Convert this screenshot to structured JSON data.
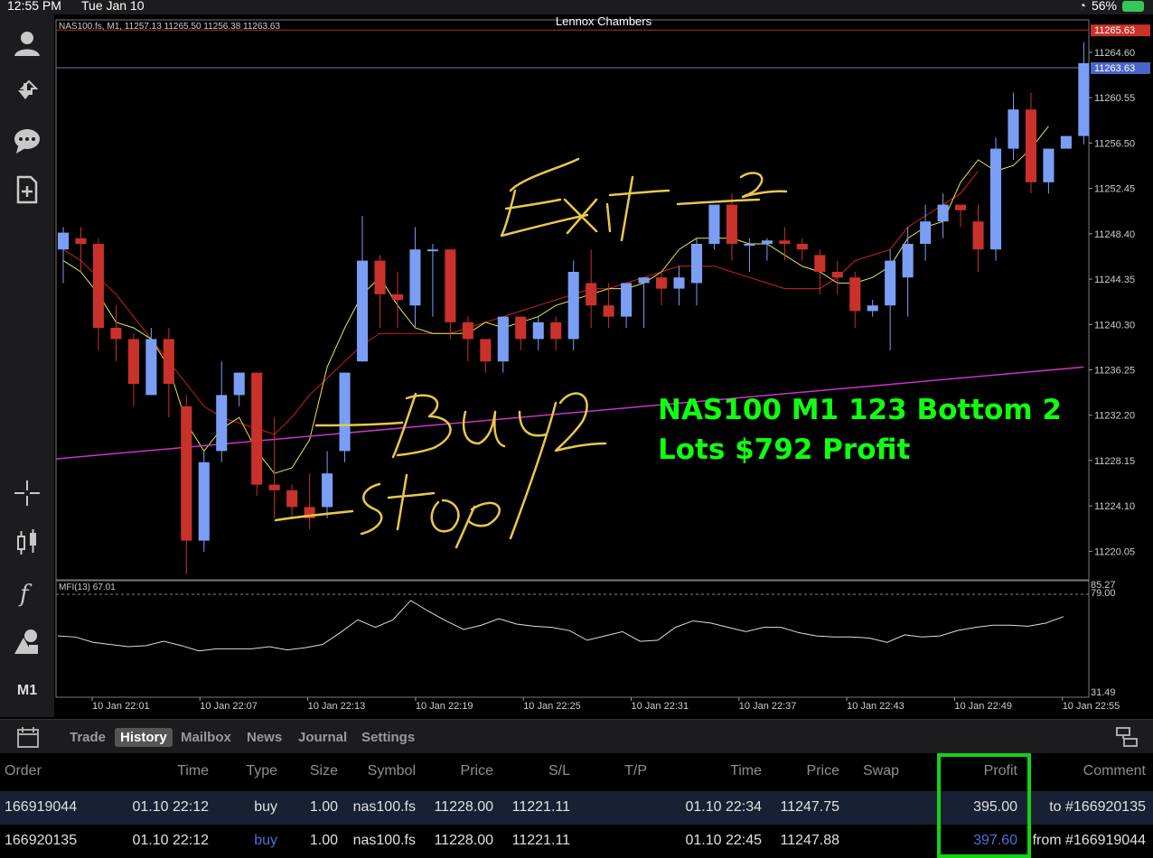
{
  "status_bar": {
    "time": "12:55 PM",
    "date": "Tue Jan 10",
    "battery": "56%"
  },
  "chart": {
    "account_title": "Lennox Chambers",
    "symbol_info": "NAS100.fs, M1, 11257.13 11265.50 11256.38 11263.63",
    "mfi_info": "MFI(13) 67.01",
    "overlay_text_line1": "NAS100 M1 123 Bottom 2",
    "overlay_text_line2": "Lots $792 Profit",
    "annotations": [
      "Exit 2",
      "Buy2",
      "Stop"
    ],
    "timeframe": "M1",
    "current_price_bid": "11263.63",
    "high_price": "11265.63",
    "mfi_levels": [
      "85.27",
      "79.00",
      "31.49"
    ],
    "colors": {
      "bull": "#7b9ef5",
      "bear": "#c8322a",
      "ma_fast": "#e8e84a",
      "ma_slow": "#cc2222",
      "ma_long": "#cc33cc",
      "mfi": "#dddddd",
      "ink": "#e8c84a",
      "overlay": "#11ff11",
      "highlight": "#13d313"
    }
  },
  "chart_data": {
    "type": "candlestick",
    "ylim": [
      11217.5,
      11267.5
    ],
    "y_ticks": [
      "11264.60",
      "11260.55",
      "11256.50",
      "11252.45",
      "11248.40",
      "11244.35",
      "11240.30",
      "11236.25",
      "11232.20",
      "11228.15",
      "11224.10",
      "11220.05"
    ],
    "x_ticks": [
      "10 Jan 22:01",
      "10 Jan 22:07",
      "10 Jan 22:13",
      "10 Jan 22:19",
      "10 Jan 22:25",
      "10 Jan 22:31",
      "10 Jan 22:37",
      "10 Jan 22:43",
      "10 Jan 22:49",
      "10 Jan 22:55"
    ],
    "candles": [
      {
        "o": 11247,
        "h": 11249,
        "c": 11248.5,
        "l": 11244
      },
      {
        "o": 11248,
        "h": 11249,
        "c": 11247.5,
        "l": 11245
      },
      {
        "o": 11247.5,
        "h": 11248,
        "c": 11240,
        "l": 11238
      },
      {
        "o": 11240,
        "h": 11242,
        "c": 11239,
        "l": 11237
      },
      {
        "o": 11239,
        "h": 11239.5,
        "c": 11235,
        "l": 11233
      },
      {
        "o": 11234,
        "h": 11240,
        "c": 11239,
        "l": 11234
      },
      {
        "o": 11239,
        "h": 11240,
        "c": 11235,
        "l": 11232
      },
      {
        "o": 11233,
        "h": 11234,
        "c": 11221,
        "l": 11218
      },
      {
        "o": 11221,
        "h": 11229,
        "c": 11228,
        "l": 11220
      },
      {
        "o": 11229,
        "h": 11237,
        "c": 11234,
        "l": 11228
      },
      {
        "o": 11234,
        "h": 11236,
        "c": 11236,
        "l": 11233
      },
      {
        "o": 11236,
        "h": 11236,
        "c": 11226,
        "l": 11225
      },
      {
        "o": 11226,
        "h": 11232,
        "c": 11225.5,
        "l": 11223
      },
      {
        "o": 11225.5,
        "h": 11226,
        "c": 11224,
        "l": 11223
      },
      {
        "o": 11224,
        "h": 11227,
        "c": 11223,
        "l": 11222
      },
      {
        "o": 11224,
        "h": 11229,
        "c": 11227,
        "l": 11223
      },
      {
        "o": 11229,
        "h": 11236,
        "c": 11236,
        "l": 11228
      },
      {
        "o": 11237,
        "h": 11250,
        "c": 11246,
        "l": 11237
      },
      {
        "o": 11246,
        "h": 11246.5,
        "c": 11243,
        "l": 11240
      },
      {
        "o": 11243,
        "h": 11245,
        "c": 11242.5,
        "l": 11240
      },
      {
        "o": 11242,
        "h": 11249,
        "c": 11247,
        "l": 11240
      },
      {
        "o": 11247,
        "h": 11247.5,
        "c": 11247,
        "l": 11241
      },
      {
        "o": 11247,
        "h": 11247,
        "c": 11240.5,
        "l": 11239
      },
      {
        "o": 11240.5,
        "h": 11241,
        "c": 11239,
        "l": 11237
      },
      {
        "o": 11239,
        "h": 11239,
        "c": 11237,
        "l": 11236
      },
      {
        "o": 11237,
        "h": 11241,
        "c": 11241,
        "l": 11236
      },
      {
        "o": 11241,
        "h": 11241,
        "c": 11239,
        "l": 11238
      },
      {
        "o": 11239,
        "h": 11241,
        "c": 11240.5,
        "l": 11238
      },
      {
        "o": 11240.5,
        "h": 11241,
        "c": 11239,
        "l": 11238
      },
      {
        "o": 11239,
        "h": 11246,
        "c": 11245,
        "l": 11238
      },
      {
        "o": 11244,
        "h": 11247,
        "c": 11242,
        "l": 11240
      },
      {
        "o": 11242,
        "h": 11244,
        "c": 11241,
        "l": 11240
      },
      {
        "o": 11241,
        "h": 11244,
        "c": 11244,
        "l": 11240
      },
      {
        "o": 11244,
        "h": 11244.5,
        "c": 11244.5,
        "l": 11240
      },
      {
        "o": 11244.5,
        "h": 11245,
        "c": 11243.5,
        "l": 11242
      },
      {
        "o": 11243.5,
        "h": 11245.5,
        "c": 11244.5,
        "l": 11242
      },
      {
        "o": 11244,
        "h": 11248,
        "c": 11247.5,
        "l": 11242
      },
      {
        "o": 11247.5,
        "h": 11250,
        "c": 11251,
        "l": 11247
      },
      {
        "o": 11251,
        "h": 11252,
        "c": 11247.5,
        "l": 11246
      },
      {
        "o": 11247.5,
        "h": 11248,
        "c": 11247.5,
        "l": 11245
      },
      {
        "o": 11247.5,
        "h": 11248,
        "c": 11247.8,
        "l": 11246
      },
      {
        "o": 11247.8,
        "h": 11249,
        "c": 11247.5,
        "l": 11246
      },
      {
        "o": 11247.5,
        "h": 11248,
        "c": 11247,
        "l": 11246
      },
      {
        "o": 11246.5,
        "h": 11247,
        "c": 11245,
        "l": 11243
      },
      {
        "o": 11245,
        "h": 11246,
        "c": 11244.5,
        "l": 11243
      },
      {
        "o": 11244.5,
        "h": 11245,
        "c": 11241.5,
        "l": 11240
      },
      {
        "o": 11241.5,
        "h": 11242.5,
        "c": 11242,
        "l": 11241
      },
      {
        "o": 11242,
        "h": 11247,
        "c": 11246,
        "l": 11238
      },
      {
        "o": 11244.5,
        "h": 11249,
        "c": 11247.5,
        "l": 11241
      },
      {
        "o": 11247.5,
        "h": 11251,
        "c": 11249.5,
        "l": 11246
      },
      {
        "o": 11249.5,
        "h": 11252,
        "c": 11251,
        "l": 11248
      },
      {
        "o": 11251,
        "h": 11251,
        "c": 11250.5,
        "l": 11249
      },
      {
        "o": 11249.5,
        "h": 11251,
        "c": 11247,
        "l": 11245
      },
      {
        "o": 11247,
        "h": 11257,
        "c": 11256,
        "l": 11246
      },
      {
        "o": 11256,
        "h": 11261,
        "c": 11259.5,
        "l": 11255
      },
      {
        "o": 11259.5,
        "h": 11261,
        "c": 11253,
        "l": 11252
      },
      {
        "o": 11253,
        "h": 11256,
        "c": 11256,
        "l": 11252
      },
      {
        "o": 11256,
        "h": 11256,
        "c": 11257.13,
        "l": 11256
      },
      {
        "o": 11257.13,
        "h": 11265.5,
        "c": 11263.63,
        "l": 11256.38
      }
    ],
    "ma_fast": [
      11246,
      11245,
      11243,
      11240.5,
      11240,
      11239,
      11236.5,
      11231.5,
      11229,
      11231,
      11232,
      11229,
      11227,
      11227.5,
      11230,
      11236.5,
      11240,
      11243,
      11244.5,
      11242,
      11240,
      11239.5,
      11239.5,
      11239.5,
      11240.5,
      11240,
      11240.5,
      11241,
      11242,
      11242.5,
      11243,
      11243.5,
      11243.5,
      11244,
      11245,
      11247,
      11248,
      11248,
      11248,
      11247.5,
      11247.5,
      11246.5,
      11245.5,
      11245,
      11244,
      11244,
      11244.5,
      11245.5,
      11248,
      11249,
      11249.5,
      11253,
      11255,
      11254,
      11254.5,
      11256,
      11258
    ],
    "ma_slow": [
      11247,
      11246,
      11244.5,
      11243,
      11241,
      11239,
      11237,
      11235,
      11233,
      11232,
      11231.5,
      11231,
      11230.5,
      11232,
      11234,
      11235.5,
      11237,
      11238.5,
      11239.5,
      11239.5,
      11239.5,
      11239.5,
      11239.5,
      11240,
      11240.5,
      11241,
      11241.5,
      11242,
      11242.5,
      11243,
      11243.5,
      11243.5,
      11244,
      11244.5,
      11245,
      11245.5,
      11245.5,
      11245.5,
      11245,
      11244.5,
      11244,
      11243.5,
      11243.5,
      11243.5,
      11244.5,
      11246,
      11246.5,
      11247,
      11249,
      11250,
      11251,
      11252,
      11254
    ],
    "ma_long": [
      11228.3,
      11236.5
    ],
    "mfi": [
      52,
      51,
      46,
      44,
      42,
      43,
      47,
      43,
      38,
      40,
      40,
      40,
      42,
      39,
      41,
      44,
      55,
      67,
      60,
      67,
      85,
      75,
      66,
      58,
      62,
      68,
      63,
      61,
      60,
      57,
      48,
      52,
      56,
      47,
      48,
      60,
      66,
      64,
      60,
      56,
      60,
      60,
      55,
      52,
      51,
      51,
      50,
      46,
      53,
      51,
      52,
      57,
      60,
      62,
      62,
      61,
      64,
      70
    ]
  },
  "tabs": [
    "Trade",
    "History",
    "Mailbox",
    "News",
    "Journal",
    "Settings"
  ],
  "history": {
    "headers": [
      "Order",
      "Time",
      "Type",
      "Size",
      "Symbol",
      "Price",
      "S/L",
      "T/P",
      "Time",
      "Price",
      "Swap",
      "Profit",
      "Comment"
    ],
    "rows": [
      [
        "166919044",
        "01.10 22:12",
        "buy",
        "1.00",
        "nas100.fs",
        "11228.00",
        "11221.11",
        "",
        "01.10 22:34",
        "11247.75",
        "",
        "395.00",
        "to #166920135"
      ],
      [
        "166920135",
        "01.10 22:12",
        "buy",
        "1.00",
        "nas100.fs",
        "11228.00",
        "11221.11",
        "",
        "01.10 22:45",
        "11247.88",
        "",
        "397.60",
        "from #166919044"
      ]
    ]
  }
}
